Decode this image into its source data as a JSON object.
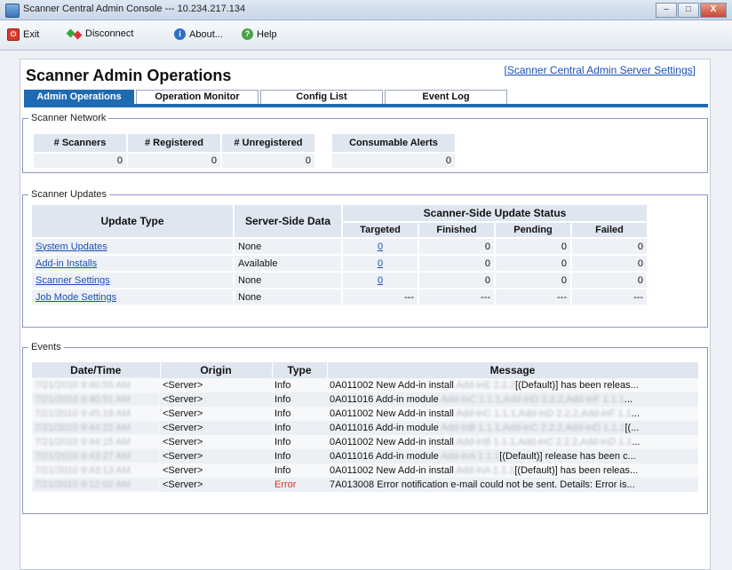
{
  "window": {
    "title": "Scanner Central Admin Console --- 10.234.217.134",
    "controls": [
      "–",
      "□",
      "X"
    ]
  },
  "toolbar": {
    "exit": "Exit",
    "disconnect": "Disconnect",
    "about": "About...",
    "help": "Help",
    "icons": {
      "exit": "exit-icon",
      "disconnect": "disconnect-icon",
      "about": "info-icon",
      "help": "help-icon"
    }
  },
  "header": {
    "title": "Scanner Admin Operations",
    "server_settings_link": "Scanner Central Admin Server Settings"
  },
  "tabs": [
    {
      "label": "Admin Operations",
      "active": true
    },
    {
      "label": "Operation Monitor",
      "active": false
    },
    {
      "label": "Config List",
      "active": false
    },
    {
      "label": "Event Log",
      "active": false
    }
  ],
  "network": {
    "legend": "Scanner Network",
    "headers": [
      "# Scanners",
      "# Registered",
      "# Unregistered"
    ],
    "values": [
      "0",
      "0",
      "0"
    ],
    "alerts_header": "Consumable Alerts",
    "alerts_value": "0"
  },
  "updates": {
    "legend": "Scanner Updates",
    "col_update_type": "Update Type",
    "col_server_side": "Server-Side Data",
    "col_status_group": "Scanner-Side Update Status",
    "col_targeted": "Targeted",
    "col_finished": "Finished",
    "col_pending": "Pending",
    "col_failed": "Failed",
    "rows": [
      {
        "type": "System Updates",
        "server": "None",
        "targeted": "0",
        "finished": "0",
        "pending": "0",
        "failed": "0"
      },
      {
        "type": "Add-in Installs",
        "server": "Available",
        "targeted": "0",
        "finished": "0",
        "pending": "0",
        "failed": "0"
      },
      {
        "type": "Scanner Settings",
        "server": "None",
        "targeted": "0",
        "finished": "0",
        "pending": "0",
        "failed": "0"
      },
      {
        "type": "Job Mode Settings",
        "server": "None",
        "targeted": "---",
        "finished": "---",
        "pending": "---",
        "failed": "---"
      }
    ]
  },
  "events": {
    "legend": "Events",
    "col_datetime": "Date/Time",
    "col_origin": "Origin",
    "col_type": "Type",
    "col_message": "Message",
    "rows": [
      {
        "datetime": "7/21/2010 9:40:55 AM",
        "origin": "<Server>",
        "type": "Info",
        "code": "0A011002",
        "msg": "New Add-in install",
        "redacted": "Add-inE 2.2.2",
        "msg2": "[(Default)] has been releas..."
      },
      {
        "datetime": "7/21/2010 9:40:51 AM",
        "origin": "<Server>",
        "type": "Info",
        "code": "0A011016",
        "msg": "Add-in module",
        "redacted": "Add-inC 1.1.1,Add-inD 2.2.2,Add-inF 1.1.1",
        "msg2": "..."
      },
      {
        "datetime": "7/21/2010 9:45:19 AM",
        "origin": "<Server>",
        "type": "Info",
        "code": "0A011002",
        "msg": "New Add-in install",
        "redacted": "Add-inC 1.1.1,Add-inD 2.2.2,Add-inF 1.1",
        "msg2": "..."
      },
      {
        "datetime": "7/21/2010 9:44:22 AM",
        "origin": "<Server>",
        "type": "Info",
        "code": "0A011016",
        "msg": "Add-in module",
        "redacted": "Add-inB 1.1.1,Add-inC 2.2.2,Add-inD 1.1.1",
        "msg2": "[(..."
      },
      {
        "datetime": "7/21/2010 9:44:15 AM",
        "origin": "<Server>",
        "type": "Info",
        "code": "0A011002",
        "msg": "New Add-in install",
        "redacted": "Add-inB 1.1.1,Add-inC 2.2.2,Add-inD 1.1",
        "msg2": "..."
      },
      {
        "datetime": "7/21/2010 9:43:27 AM",
        "origin": "<Server>",
        "type": "Info",
        "code": "0A011016",
        "msg": "Add-in module",
        "redacted": "Add-inA 1.1.1",
        "msg2": "[(Default)] release has been c..."
      },
      {
        "datetime": "7/21/2010 9:43:13 AM",
        "origin": "<Server>",
        "type": "Info",
        "code": "0A011002",
        "msg": "New Add-in install",
        "redacted": "Add-inA 1.1.1",
        "msg2": "[(Default)] has been releas..."
      },
      {
        "datetime": "7/21/2010 9:12:02 AM",
        "origin": "<Server>",
        "type": "Error",
        "code": "7A013008",
        "msg": "Error notification e-mail could not be sent. Details: Error is...",
        "redacted": "",
        "msg2": ""
      }
    ]
  },
  "colors": {
    "accent": "#1e6ab3",
    "link": "#1a4fb5",
    "error": "#e23020",
    "group_border": "#8f95c8"
  }
}
